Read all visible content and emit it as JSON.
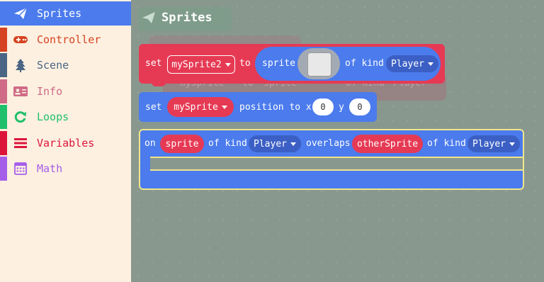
{
  "toolbox": {
    "items": [
      {
        "label": "Sprites",
        "color": "#4b7bec",
        "icon": "paper-plane-icon"
      },
      {
        "label": "Controller",
        "color": "#d54322",
        "icon": "gamepad-icon"
      },
      {
        "label": "Scene",
        "color": "#4b6584",
        "icon": "tree-icon"
      },
      {
        "label": "Info",
        "color": "#cf6a87",
        "icon": "id-card-icon"
      },
      {
        "label": "Loops",
        "color": "#20bf6b",
        "icon": "loop-arrow-icon"
      },
      {
        "label": "Variables",
        "color": "#dc143c",
        "icon": "lines-icon"
      },
      {
        "label": "Math",
        "color": "#a55eea",
        "icon": "calculator-icon"
      }
    ]
  },
  "flyout": {
    "title": "Sprites"
  },
  "blocks": {
    "set_sprite": {
      "set": "set",
      "var": "mySprite2",
      "to": "to",
      "sprite": "sprite",
      "of_kind": "of kind",
      "kind": "Player"
    },
    "ghost_set_sprite": {
      "var": "mySprite",
      "to": "to",
      "sprite": "sprite",
      "of_kind": "of kind",
      "kind": "Player"
    },
    "set_position": {
      "set": "set",
      "var": "mySprite",
      "position_to": "position to x",
      "x": "0",
      "y_label": "y",
      "y": "0"
    },
    "overlaps": {
      "on": "on",
      "sprite": "sprite",
      "of_kind_1": "of kind",
      "kind_1": "Player",
      "overlaps": "overlaps",
      "other": "otherSprite",
      "of_kind_2": "of kind",
      "kind_2": "Player"
    }
  },
  "colors": {
    "sprites_block": "#4b7bec",
    "variables_block": "#e63a54",
    "selection_outline": "#f0e68c"
  }
}
